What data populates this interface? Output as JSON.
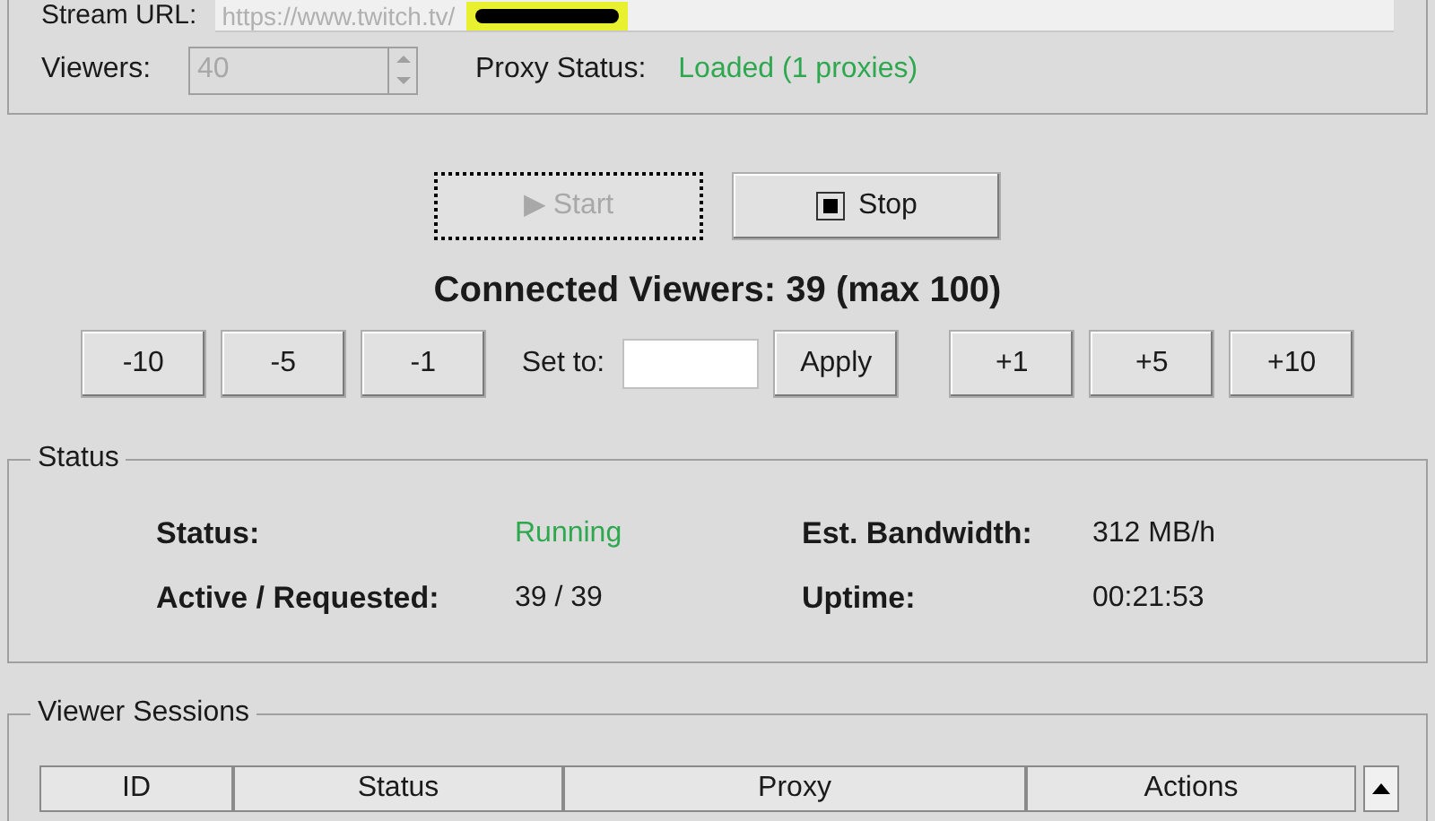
{
  "stream_url": {
    "label": "Stream URL:",
    "value": "https://www.twitch.tv/",
    "disabled": true
  },
  "viewers": {
    "label": "Viewers:",
    "value": "40",
    "disabled": true
  },
  "proxy_status": {
    "label": "Proxy Status:",
    "value": "Loaded (1 proxies)"
  },
  "start_button": {
    "label": "▶ Start",
    "disabled": true,
    "focused": true
  },
  "stop_button": {
    "label": "Stop",
    "disabled": false
  },
  "connected_viewers": "Connected Viewers: 39 (max 100)",
  "decrease_buttons": [
    "-10",
    "-5",
    "-1"
  ],
  "set_to": {
    "label": "Set to:",
    "button": "Apply"
  },
  "increase_buttons": [
    "+1",
    "+5",
    "+10"
  ],
  "status_panel": {
    "title": "Status",
    "items": [
      {
        "label": "Status:",
        "value": "Running",
        "kind": "good"
      },
      {
        "label": "Est. Bandwidth:",
        "value": "312 MB/h",
        "kind": "plain"
      },
      {
        "label": "Active / Requested:",
        "value": "39 / 39",
        "kind": "plain"
      },
      {
        "label": "Uptime:",
        "value": "00:21:53",
        "kind": "plain"
      }
    ]
  },
  "sessions_panel": {
    "title": "Viewer Sessions",
    "columns": [
      "ID",
      "Status",
      "Proxy",
      "Actions"
    ]
  }
}
